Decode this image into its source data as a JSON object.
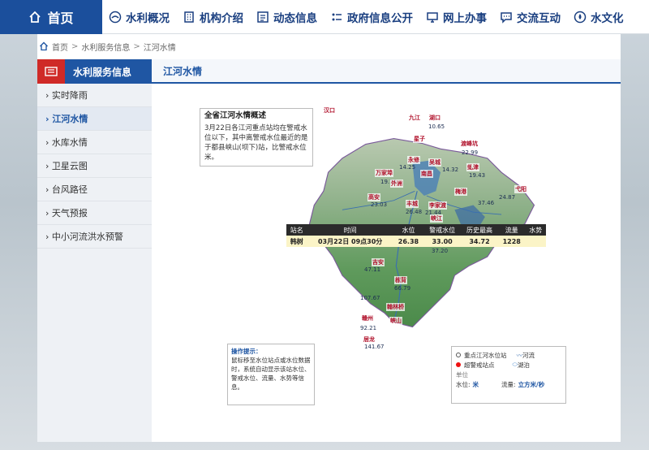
{
  "nav": {
    "home": "首页",
    "items": [
      "水利概况",
      "机构介绍",
      "动态信息",
      "政府信息公开",
      "网上办事",
      "交流互动",
      "水文化"
    ]
  },
  "breadcrumb": [
    "首页",
    "水利服务信息",
    "江河水情"
  ],
  "sidebar": {
    "header": "水利服务信息",
    "items": [
      "实时降雨",
      "江河水情",
      "水库水情",
      "卫星云图",
      "台风路径",
      "天气预报",
      "中小河流洪水预警"
    ]
  },
  "tab_title": "江河水情",
  "summary": {
    "title": "全省江河水情概述",
    "text": "3月22日各江河重点站均在警戒水位以下，其中离警戒水位最近的是于都县峡山(坝下)站，比警戒水位米。"
  },
  "table": {
    "headers": [
      "站名",
      "时间",
      "水位",
      "警戒水位",
      "历史最高",
      "流量",
      "水势"
    ],
    "row": [
      "韩树",
      "03月22日 09点30分",
      "26.38",
      "33.00",
      "34.72",
      "1228",
      ""
    ]
  },
  "tips": {
    "title": "操作提示：",
    "text": "鼠标移至水位站点或水位数据时，系统自动显示该站水位、警戒水位、流量、水势等信息。"
  },
  "legend": {
    "station": "重点江河水位站",
    "river": "河流",
    "warning": "超警戒站点",
    "lake": "湖泊",
    "unit_label": "单位",
    "level_label": "水位:",
    "level_unit": "米",
    "flow_label": "流量:",
    "flow_unit": "立方米/秒"
  },
  "map": {
    "stations": [
      {
        "name": "九江",
        "value": "10.65"
      },
      {
        "name": "湖口",
        "value": ""
      },
      {
        "name": "星子",
        "value": ""
      },
      {
        "name": "渡峰坑",
        "value": "22.99"
      },
      {
        "name": "永修",
        "value": "14.25"
      },
      {
        "name": "吴城",
        "value": ""
      },
      {
        "name": "虬津",
        "value": "14.32"
      },
      {
        "name": "万家埠",
        "value": "19.43"
      },
      {
        "name": "南昌",
        "value": "19.79"
      },
      {
        "name": "外洲",
        "value": ""
      },
      {
        "name": "梅港",
        "value": "24.87"
      },
      {
        "name": "弋阳",
        "value": "37.46"
      },
      {
        "name": "高安",
        "value": "23.03"
      },
      {
        "name": "丰城",
        "value": "26.48"
      },
      {
        "name": "李家渡",
        "value": "21.44"
      },
      {
        "name": "峡江",
        "value": "37.20"
      },
      {
        "name": "吉安",
        "value": "47.11"
      },
      {
        "name": "栋背",
        "value": "66.79"
      },
      {
        "name": "翰林桥",
        "value": ""
      },
      {
        "name": "赣州",
        "value": "107.67"
      },
      {
        "name": "峡山",
        "value": "92.21"
      },
      {
        "name": "居龙",
        "value": "141.67"
      }
    ],
    "border_label": "汉口"
  },
  "colors": {
    "brand_blue": "#1f56a3",
    "nav_home": "#1b4f9c",
    "badge_red": "#cf2a27"
  }
}
